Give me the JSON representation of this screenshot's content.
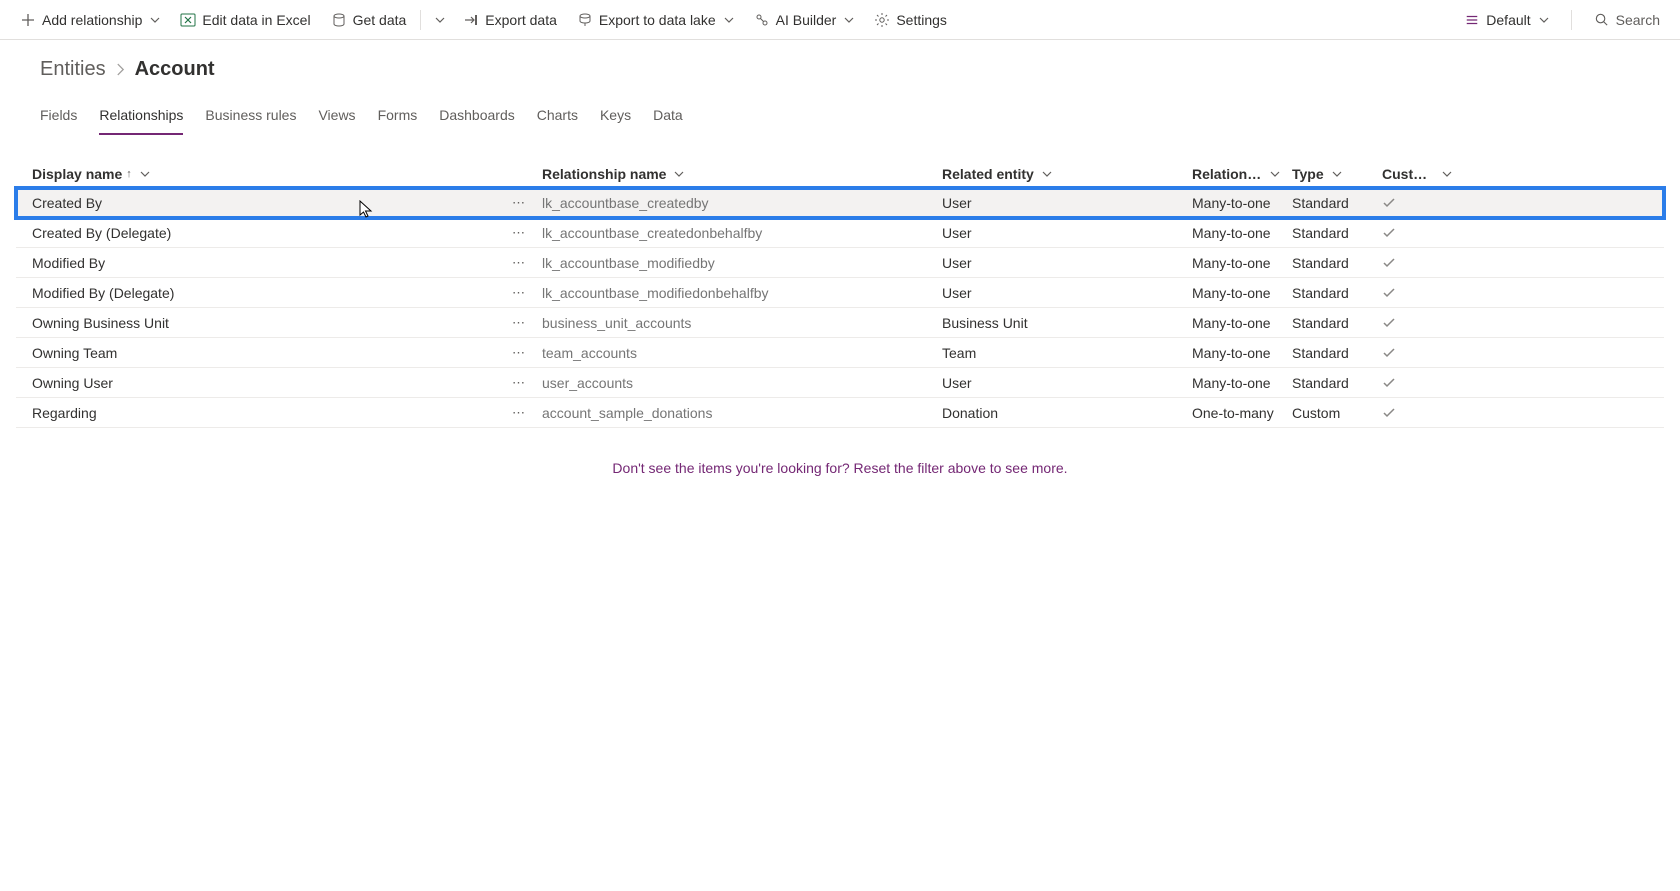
{
  "toolbar": {
    "add_relationship": "Add relationship",
    "edit_excel": "Edit data in Excel",
    "get_data": "Get data",
    "export_data": "Export data",
    "export_data_lake": "Export to data lake",
    "ai_builder": "AI Builder",
    "settings": "Settings",
    "default": "Default",
    "search_placeholder": "Search"
  },
  "breadcrumb": {
    "parent": "Entities",
    "current": "Account"
  },
  "tabs": [
    {
      "label": "Fields",
      "active": false
    },
    {
      "label": "Relationships",
      "active": true
    },
    {
      "label": "Business rules",
      "active": false
    },
    {
      "label": "Views",
      "active": false
    },
    {
      "label": "Forms",
      "active": false
    },
    {
      "label": "Dashboards",
      "active": false
    },
    {
      "label": "Charts",
      "active": false
    },
    {
      "label": "Keys",
      "active": false
    },
    {
      "label": "Data",
      "active": false
    }
  ],
  "columns": {
    "display_name": "Display name",
    "relationship_name": "Relationship name",
    "related_entity": "Related entity",
    "relationship": "Relationshi...",
    "type": "Type",
    "custom": "Custom..."
  },
  "rows": [
    {
      "display": "Created By",
      "rel": "lk_accountbase_createdby",
      "entity": "User",
      "relship": "Many-to-one",
      "type": "Standard",
      "highlight": true
    },
    {
      "display": "Created By (Delegate)",
      "rel": "lk_accountbase_createdonbehalfby",
      "entity": "User",
      "relship": "Many-to-one",
      "type": "Standard"
    },
    {
      "display": "Modified By",
      "rel": "lk_accountbase_modifiedby",
      "entity": "User",
      "relship": "Many-to-one",
      "type": "Standard"
    },
    {
      "display": "Modified By (Delegate)",
      "rel": "lk_accountbase_modifiedonbehalfby",
      "entity": "User",
      "relship": "Many-to-one",
      "type": "Standard"
    },
    {
      "display": "Owning Business Unit",
      "rel": "business_unit_accounts",
      "entity": "Business Unit",
      "relship": "Many-to-one",
      "type": "Standard"
    },
    {
      "display": "Owning Team",
      "rel": "team_accounts",
      "entity": "Team",
      "relship": "Many-to-one",
      "type": "Standard"
    },
    {
      "display": "Owning User",
      "rel": "user_accounts",
      "entity": "User",
      "relship": "Many-to-one",
      "type": "Standard"
    },
    {
      "display": "Regarding",
      "rel": "account_sample_donations",
      "entity": "Donation",
      "relship": "One-to-many",
      "type": "Custom"
    }
  ],
  "footer_msg": "Don't see the items you're looking for? Reset the filter above to see more."
}
